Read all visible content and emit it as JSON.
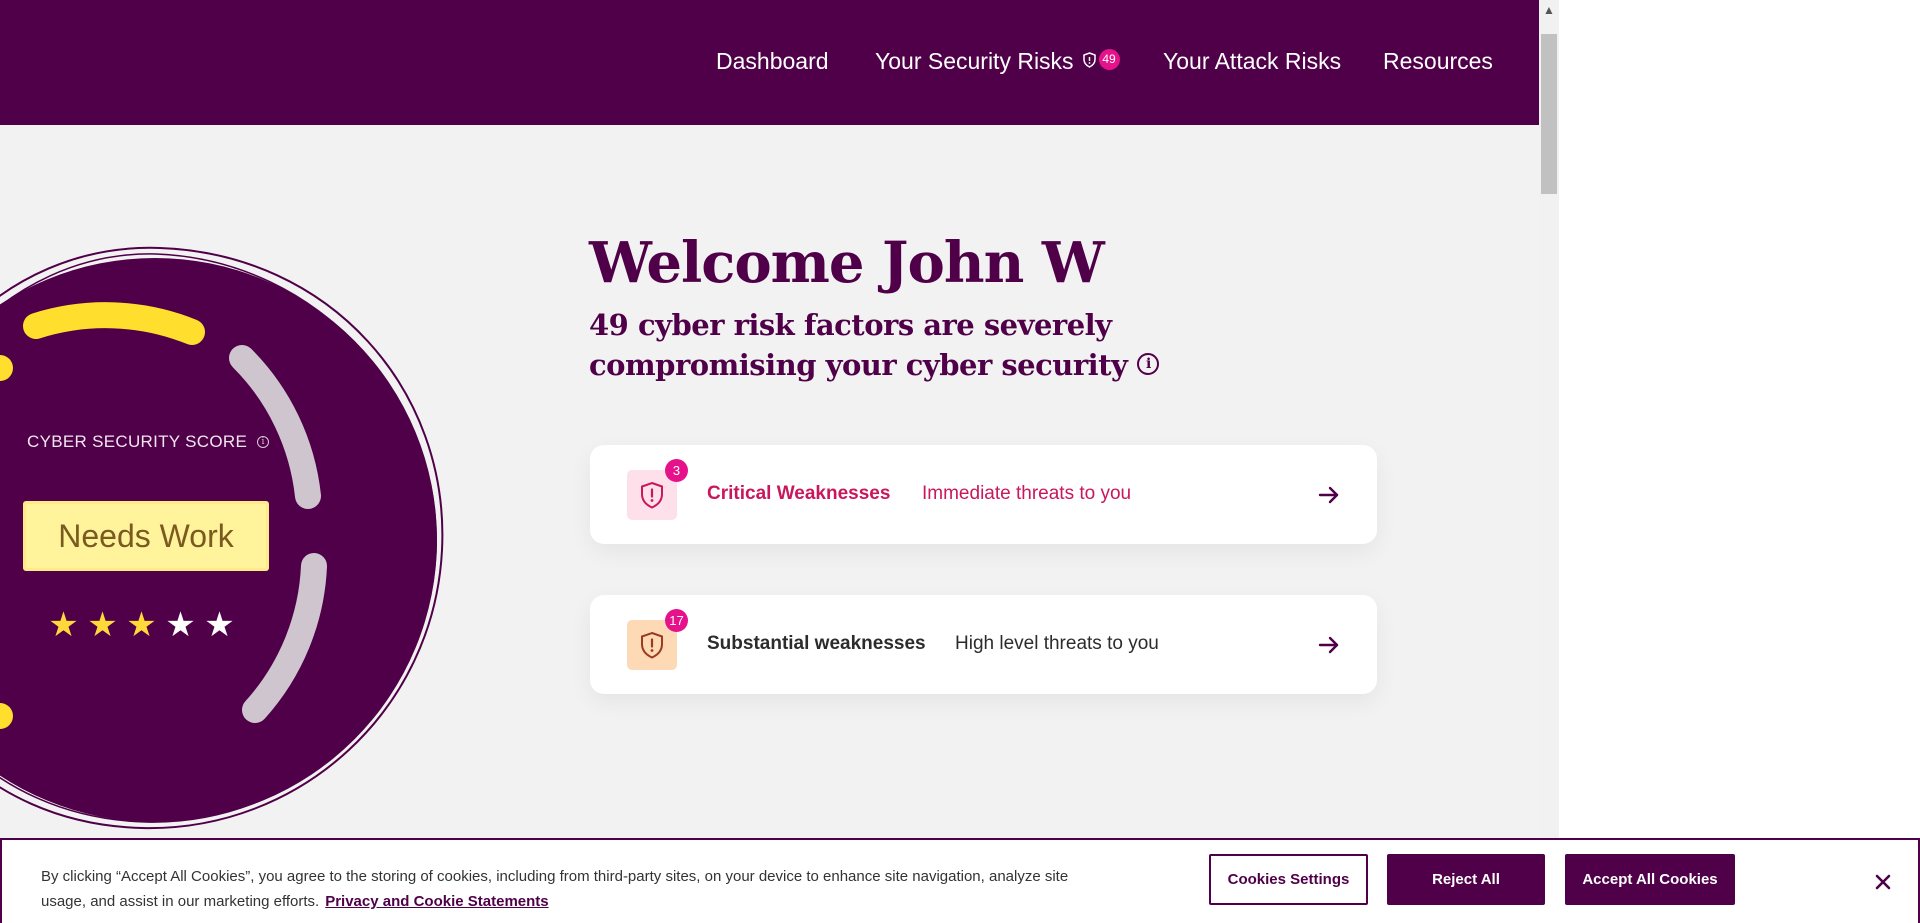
{
  "nav": {
    "items": [
      {
        "label": "Dashboard"
      },
      {
        "label": "Your Security Risks",
        "badge": "49",
        "icon": "shield-icon"
      },
      {
        "label": "Your Attack Risks"
      },
      {
        "label": "Resources"
      }
    ]
  },
  "score": {
    "label": "CYBER SECURITY SCORE",
    "info_glyph": "i",
    "rating": "Needs Work",
    "stars_filled": 3,
    "stars_total": 5,
    "colors": {
      "circle": "#4f0048",
      "arc_active": "#ffde2e",
      "arc_inactive": "#cfc5cf",
      "badge": "#fff39c"
    }
  },
  "welcome": {
    "title": "Welcome John W",
    "subtitle": "49 cyber risk factors are severely compromising your cyber security",
    "info_glyph": "i"
  },
  "cards": [
    {
      "title": "Critical Weaknesses",
      "description": "Immediate threats to you",
      "count": "3",
      "icon": "shield-alert-icon",
      "color": "#c8175d",
      "icon_bg": "#fde0ea"
    },
    {
      "title": "Substantial weaknesses",
      "description": "High level threats to you",
      "count": "17",
      "icon": "shield-alert-icon",
      "color": "#2c2c2c",
      "icon_bg": "#fdd9b5"
    }
  ],
  "cookie": {
    "text": "By clicking “Accept All Cookies”, you agree to the storing of cookies, including from third-party sites, on your device to enhance site navigation, analyze site usage, and assist in our marketing efforts.",
    "link": "Privacy and Cookie Statements",
    "settings_label": "Cookies Settings",
    "reject_label": "Reject All",
    "accept_label": "Accept All Cookies",
    "close_icon": "close-icon"
  },
  "colors": {
    "brand": "#4f0048",
    "accent": "#e5128b"
  }
}
